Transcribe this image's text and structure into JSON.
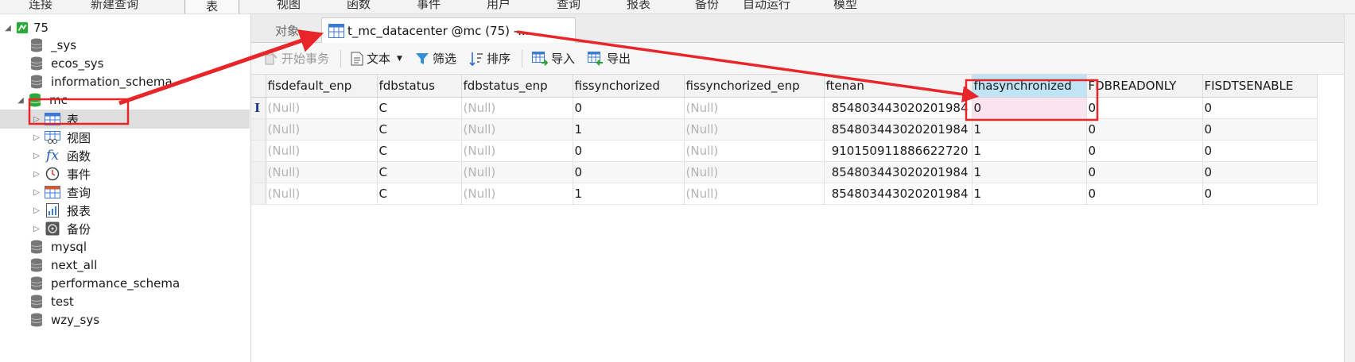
{
  "menubar": {
    "items": [
      "连接",
      "新建查询",
      "表",
      "视图",
      "函数",
      "事件",
      "用户",
      "查询",
      "报表",
      "备份",
      "自动运行",
      "模型"
    ]
  },
  "tree": {
    "connection": "75",
    "databases_top": [
      "_sys",
      "ecos_sys",
      "information_schema"
    ],
    "open_db": "mc",
    "objects": [
      {
        "label": "表",
        "icon": "table-icon"
      },
      {
        "label": "视图",
        "icon": "view-icon"
      },
      {
        "label": "函数",
        "icon": "function-icon"
      },
      {
        "label": "事件",
        "icon": "event-icon"
      },
      {
        "label": "查询",
        "icon": "query-icon"
      },
      {
        "label": "报表",
        "icon": "report-icon"
      },
      {
        "label": "备份",
        "icon": "backup-icon"
      }
    ],
    "databases_bottom": [
      "mysql",
      "next_all",
      "performance_schema",
      "test",
      "wzy_sys"
    ]
  },
  "tabs": {
    "objects_label": "对象",
    "active_label": "t_mc_datacenter @mc (75) -..."
  },
  "toolbar": {
    "begin_transaction": "开始事务",
    "text": "文本",
    "filter": "筛选",
    "sort": "排序",
    "import": "导入",
    "export": "导出"
  },
  "grid": {
    "columns": [
      "fisdefault_enp",
      "fdbstatus",
      "fdbstatus_enp",
      "fissynchorized",
      "fissynchorized_enp",
      "ftenan",
      "fhasynchronized",
      "FDBREADONLY",
      "FISDTSENABLE"
    ],
    "rows": [
      [
        "(Null)",
        "C",
        "(Null)",
        "0",
        "(Null)",
        "854803443020201984",
        "0",
        "0",
        "0"
      ],
      [
        "(Null)",
        "C",
        "(Null)",
        "1",
        "(Null)",
        "854803443020201984",
        "1",
        "0",
        "0"
      ],
      [
        "(Null)",
        "C",
        "(Null)",
        "0",
        "(Null)",
        "910150911886622720",
        "1",
        "0",
        "0"
      ],
      [
        "(Null)",
        "C",
        "(Null)",
        "0",
        "(Null)",
        "854803443020201984",
        "1",
        "0",
        "0"
      ],
      [
        "(Null)",
        "C",
        "(Null)",
        "1",
        "(Null)",
        "854803443020201984",
        "1",
        "0",
        "0"
      ]
    ],
    "cursor_marker": "I"
  },
  "colors": {
    "annotation_red": "#e8262a",
    "header_highlight": "#bfe4f6",
    "cell_highlight": "#fbe3f0",
    "db_icon_green": "#2eaa3a",
    "null_text": "#b4b4b4"
  }
}
